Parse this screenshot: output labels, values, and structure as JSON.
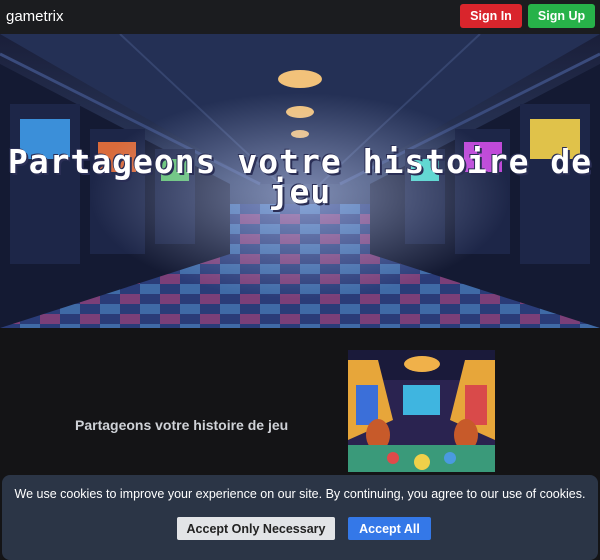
{
  "navbar": {
    "brand": "gametrix",
    "sign_in_label": "Sign In",
    "sign_up_label": "Sign Up"
  },
  "hero": {
    "title": "Partageons votre histoire de jeu"
  },
  "section": {
    "text": "Partageons votre histoire de jeu"
  },
  "cookie_banner": {
    "message": "We use cookies to improve your experience on our site. By continuing, you agree to our use of cookies.",
    "necessary_label": "Accept Only Necessary",
    "accept_all_label": "Accept All"
  },
  "colors": {
    "sign_in": "#d9252c",
    "sign_up": "#27b249",
    "accept_all": "#3478e8",
    "banner_bg": "#2b3546"
  }
}
